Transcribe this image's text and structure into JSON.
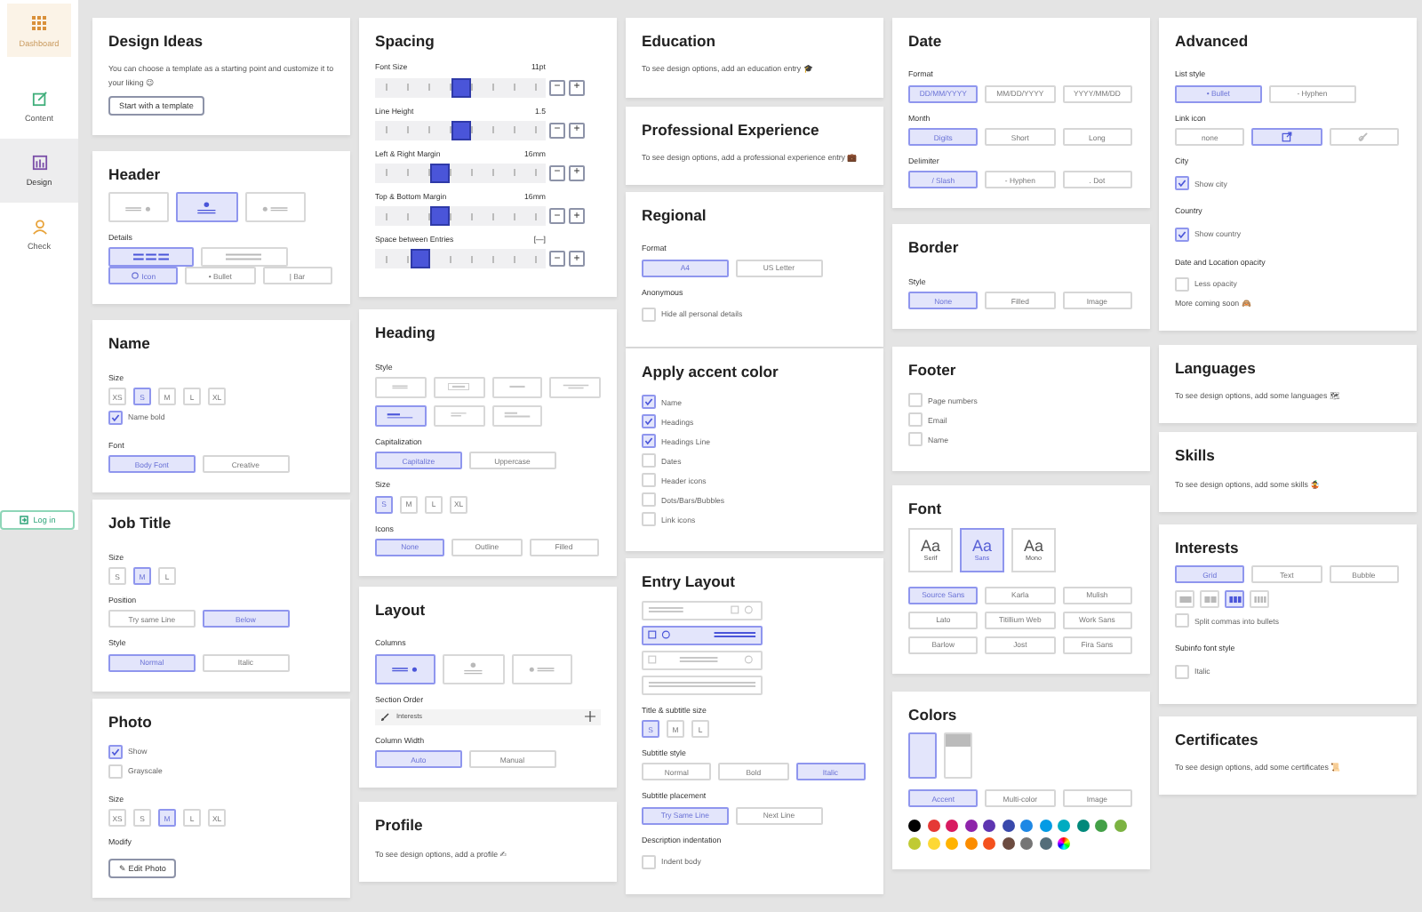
{
  "sidebar": {
    "items": [
      {
        "label": "Dashboard",
        "selected": false,
        "hovered": true,
        "color": "#d9903a"
      },
      {
        "label": "Content",
        "selected": false,
        "hovered": false,
        "color": "#3fae7a"
      },
      {
        "label": "Design",
        "selected": true,
        "hovered": false,
        "color": "#7b4fa8"
      },
      {
        "label": "Check",
        "selected": false,
        "hovered": false,
        "color": "#e8a33a"
      }
    ],
    "login": "Log in"
  },
  "columns": [
    {
      "cards": [
        {
          "title": "Design Ideas",
          "blocks": [
            {
              "kind": "text",
              "text": "You can choose a template as a starting point and customize it to your liking 😉"
            },
            {
              "kind": "button",
              "label": "Start with a template"
            }
          ]
        },
        {
          "title": "Header",
          "blocks": [
            {
              "kind": "shapes-large",
              "options": [
                {
                  "selected": false
                },
                {
                  "selected": true
                },
                {
                  "selected": false
                }
              ]
            },
            {
              "kind": "label",
              "text": "Details"
            },
            {
              "kind": "shapes-wide",
              "options": [
                {
                  "selected": true
                },
                {
                  "selected": false
                }
              ]
            },
            {
              "kind": "choices",
              "options": [
                {
                  "label": "Icon",
                  "selected": true,
                  "icon": true
                },
                {
                  "label": "• Bullet",
                  "selected": false,
                  "icon": false
                },
                {
                  "label": "| Bar",
                  "selected": false,
                  "icon": false
                }
              ]
            }
          ]
        },
        {
          "title": "Name",
          "blocks": [
            {
              "kind": "label",
              "text": "Size"
            },
            {
              "kind": "sizes",
              "options": [
                {
                  "label": "XS",
                  "selected": false
                },
                {
                  "label": "S",
                  "selected": true
                },
                {
                  "label": "M",
                  "selected": false
                },
                {
                  "label": "L",
                  "selected": false
                },
                {
                  "label": "XL",
                  "selected": false
                }
              ]
            },
            {
              "kind": "checkbox",
              "label": "Name bold",
              "checked": true
            },
            {
              "kind": "label",
              "text": "Font"
            },
            {
              "kind": "choices",
              "options": [
                {
                  "label": "Body Font",
                  "selected": true
                },
                {
                  "label": "Creative",
                  "selected": false
                }
              ]
            }
          ]
        },
        {
          "title": "Job Title",
          "blocks": [
            {
              "kind": "label",
              "text": "Size"
            },
            {
              "kind": "sizes",
              "options": [
                {
                  "label": "S",
                  "selected": false
                },
                {
                  "label": "M",
                  "selected": true
                },
                {
                  "label": "L",
                  "selected": false
                }
              ]
            },
            {
              "kind": "label",
              "text": "Position"
            },
            {
              "kind": "choices",
              "options": [
                {
                  "label": "Try same Line",
                  "selected": false
                },
                {
                  "label": "Below",
                  "selected": true
                }
              ]
            },
            {
              "kind": "label",
              "text": "Style"
            },
            {
              "kind": "choices",
              "options": [
                {
                  "label": "Normal",
                  "selected": true
                },
                {
                  "label": "Italic",
                  "selected": false
                }
              ]
            }
          ]
        },
        {
          "title": "Photo",
          "blocks": [
            {
              "kind": "checkbox",
              "label": "Show",
              "checked": true
            },
            {
              "kind": "checkbox",
              "label": "Grayscale",
              "checked": false
            },
            {
              "kind": "label",
              "text": "Size"
            },
            {
              "kind": "sizes",
              "options": [
                {
                  "label": "XS",
                  "selected": false
                },
                {
                  "label": "S",
                  "selected": false
                },
                {
                  "label": "M",
                  "selected": true
                },
                {
                  "label": "L",
                  "selected": false
                },
                {
                  "label": "XL",
                  "selected": false
                }
              ]
            },
            {
              "kind": "label",
              "text": "Modify"
            },
            {
              "kind": "button",
              "label": "✎ Edit Photo"
            }
          ]
        }
      ]
    },
    {
      "cards": [
        {
          "title": "Spacing",
          "blocks": [
            {
              "kind": "slider",
              "label": "Font Size",
              "reading": "11pt",
              "level": 0.5,
              "minus": "−",
              "plus": "+"
            },
            {
              "kind": "slider",
              "label": "Line Height",
              "reading": "1.5",
              "level": 0.5,
              "minus": "−",
              "plus": "+"
            },
            {
              "kind": "slider",
              "label": "Left & Right Margin",
              "reading": "16mm",
              "level": 0.36,
              "minus": "−",
              "plus": "+"
            },
            {
              "kind": "slider",
              "label": "Top & Bottom Margin",
              "reading": "16mm",
              "level": 0.36,
              "minus": "−",
              "plus": "+"
            },
            {
              "kind": "slider",
              "label": "Space between Entries",
              "reading": "[—]",
              "level": 0.24,
              "minus": "−",
              "plus": "+"
            }
          ]
        },
        {
          "title": "Heading",
          "blocks": [
            {
              "kind": "label",
              "text": "Style"
            },
            {
              "kind": "shapes-grid",
              "options": [
                {
                  "selected": false
                },
                {
                  "selected": false
                },
                {
                  "selected": false
                },
                {
                  "selected": false
                },
                {
                  "selected": true
                },
                {
                  "selected": false
                },
                {
                  "selected": false
                }
              ]
            },
            {
              "kind": "label",
              "text": "Capitalization"
            },
            {
              "kind": "choices",
              "options": [
                {
                  "label": "Capitalize",
                  "selected": true
                },
                {
                  "label": "Uppercase",
                  "selected": false
                }
              ]
            },
            {
              "kind": "label",
              "text": "Size"
            },
            {
              "kind": "sizes",
              "options": [
                {
                  "label": "S",
                  "selected": true
                },
                {
                  "label": "M",
                  "selected": false
                },
                {
                  "label": "L",
                  "selected": false
                },
                {
                  "label": "XL",
                  "selected": false
                }
              ]
            },
            {
              "kind": "label",
              "text": "Icons"
            },
            {
              "kind": "choices",
              "options": [
                {
                  "label": "None",
                  "selected": true
                },
                {
                  "label": "Outline",
                  "selected": false
                },
                {
                  "label": "Filled",
                  "selected": false
                }
              ]
            }
          ]
        },
        {
          "title": "Layout",
          "blocks": [
            {
              "kind": "label",
              "text": "Columns"
            },
            {
              "kind": "shapes-large",
              "options": [
                {
                  "selected": true
                },
                {
                  "selected": false
                },
                {
                  "selected": false
                }
              ]
            },
            {
              "kind": "label",
              "text": "Section Order"
            },
            {
              "kind": "sort-row",
              "text": "Interests"
            },
            {
              "kind": "label",
              "text": "Column Width"
            },
            {
              "kind": "choices",
              "options": [
                {
                  "label": "Auto",
                  "selected": true
                },
                {
                  "label": "Manual",
                  "selected": false
                }
              ]
            }
          ]
        },
        {
          "title": "Profile",
          "blocks": [
            {
              "kind": "text",
              "text": "To see design options, add a profile ✍"
            }
          ]
        }
      ]
    },
    {
      "cards": [
        {
          "title": "Education",
          "blocks": [
            {
              "kind": "text",
              "text": "To see design options, add an education entry 🎓"
            }
          ]
        },
        {
          "title": "Professional Experience",
          "blocks": [
            {
              "kind": "text",
              "text": "To see design options, add a professional experience entry 💼"
            }
          ]
        },
        {
          "title": "Regional",
          "blocks": [
            {
              "kind": "label",
              "text": "Format"
            },
            {
              "kind": "choices",
              "options": [
                {
                  "label": "A4",
                  "selected": true
                },
                {
                  "label": "US Letter",
                  "selected": false
                }
              ]
            },
            {
              "kind": "label",
              "text": "Anonymous"
            },
            {
              "kind": "checkbox",
              "label": "Hide all personal details",
              "checked": false
            }
          ]
        },
        {
          "title": "Apply accent color",
          "blocks": [
            {
              "kind": "checkbox",
              "label": "Name",
              "checked": true
            },
            {
              "kind": "checkbox",
              "label": "Headings",
              "checked": true
            },
            {
              "kind": "checkbox",
              "label": "Headings Line",
              "checked": true
            },
            {
              "kind": "checkbox",
              "label": "Dates",
              "checked": false
            },
            {
              "kind": "checkbox",
              "label": "Header icons",
              "checked": false
            },
            {
              "kind": "checkbox",
              "label": "Dots/Bars/Bubbles",
              "checked": false
            },
            {
              "kind": "checkbox",
              "label": "Link icons",
              "checked": false
            }
          ]
        },
        {
          "title": "Entry Layout",
          "blocks": [
            {
              "kind": "shapes-stack",
              "options": [
                {
                  "selected": false
                },
                {
                  "selected": true
                },
                {
                  "selected": false
                },
                {
                  "selected": false
                }
              ]
            },
            {
              "kind": "label",
              "text": "Title & subtitle size"
            },
            {
              "kind": "sizes",
              "options": [
                {
                  "label": "S",
                  "selected": true
                },
                {
                  "label": "M",
                  "selected": false
                },
                {
                  "label": "L",
                  "selected": false
                }
              ]
            },
            {
              "kind": "label",
              "text": "Subtitle style"
            },
            {
              "kind": "choices",
              "options": [
                {
                  "label": "Normal",
                  "selected": false
                },
                {
                  "label": "Bold",
                  "selected": false
                },
                {
                  "label": "Italic",
                  "selected": true
                }
              ]
            },
            {
              "kind": "label",
              "text": "Subtitle placement"
            },
            {
              "kind": "choices",
              "options": [
                {
                  "label": "Try Same Line",
                  "selected": true
                },
                {
                  "label": "Next Line",
                  "selected": false
                }
              ]
            },
            {
              "kind": "label",
              "text": "Description indentation"
            },
            {
              "kind": "checkbox",
              "label": "Indent body",
              "checked": false
            }
          ]
        }
      ]
    },
    {
      "cards": [
        {
          "title": "Date",
          "blocks": [
            {
              "kind": "label",
              "text": "Format"
            },
            {
              "kind": "choices",
              "options": [
                {
                  "label": "DD/MM/YYYY",
                  "selected": true
                },
                {
                  "label": "MM/DD/YYYY",
                  "selected": false
                },
                {
                  "label": "YYYY/MM/DD",
                  "selected": false
                }
              ]
            },
            {
              "kind": "label",
              "text": "Month"
            },
            {
              "kind": "choices",
              "options": [
                {
                  "label": "Digits",
                  "selected": true
                },
                {
                  "label": "Short",
                  "selected": false
                },
                {
                  "label": "Long",
                  "selected": false
                }
              ]
            },
            {
              "kind": "label",
              "text": "Delimiter"
            },
            {
              "kind": "choices",
              "options": [
                {
                  "label": "/ Slash",
                  "selected": true
                },
                {
                  "label": "- Hyphen",
                  "selected": false
                },
                {
                  "label": ". Dot",
                  "selected": false
                }
              ]
            }
          ]
        },
        {
          "title": "Border",
          "blocks": [
            {
              "kind": "label",
              "text": "Style"
            },
            {
              "kind": "choices",
              "options": [
                {
                  "label": "None",
                  "selected": true
                },
                {
                  "label": "Filled",
                  "selected": false
                },
                {
                  "label": "Image",
                  "selected": false
                }
              ]
            }
          ]
        },
        {
          "title": "Footer",
          "blocks": [
            {
              "kind": "checkbox",
              "label": "Page numbers",
              "checked": false
            },
            {
              "kind": "checkbox",
              "label": "Email",
              "checked": false
            },
            {
              "kind": "checkbox",
              "label": "Name",
              "checked": false
            }
          ]
        },
        {
          "title": "Font",
          "blocks": [
            {
              "kind": "font-tiles",
              "options": [
                {
                  "sample": "Aa",
                  "label": "Serif",
                  "selected": false
                },
                {
                  "sample": "Aa",
                  "label": "Sans",
                  "selected": true
                },
                {
                  "sample": "Aa",
                  "label": "Mono",
                  "selected": false
                }
              ]
            },
            {
              "kind": "choices",
              "options": [
                {
                  "label": "Source Sans",
                  "selected": true
                },
                {
                  "label": "Karla",
                  "selected": false
                },
                {
                  "label": "Mulish",
                  "selected": false
                },
                {
                  "label": "Lato",
                  "selected": false
                },
                {
                  "label": "Titillium Web",
                  "selected": false
                },
                {
                  "label": "Work Sans",
                  "selected": false
                },
                {
                  "label": "Barlow",
                  "selected": false
                },
                {
                  "label": "Jost",
                  "selected": false
                },
                {
                  "label": "Fira Sans",
                  "selected": false
                }
              ]
            }
          ]
        },
        {
          "title": "Colors",
          "blocks": [
            {
              "kind": "shapes-pages",
              "options": [
                {
                  "selected": true
                },
                {
                  "selected": false
                }
              ]
            },
            {
              "kind": "choices",
              "options": [
                {
                  "label": "Accent",
                  "selected": true
                },
                {
                  "label": "Multi-color",
                  "selected": false
                },
                {
                  "label": "Image",
                  "selected": false
                }
              ]
            },
            {
              "kind": "swatches",
              "picker": true,
              "colors": [
                {
                  "color": "#000000"
                },
                {
                  "color": "#e53935"
                },
                {
                  "color": "#d81b60"
                },
                {
                  "color": "#8e24aa"
                },
                {
                  "color": "#5e35b1"
                },
                {
                  "color": "#3949ab"
                },
                {
                  "color": "#1e88e5"
                },
                {
                  "color": "#039be5"
                },
                {
                  "color": "#00acc1"
                },
                {
                  "color": "#00897b"
                },
                {
                  "color": "#43a047"
                },
                {
                  "color": "#7cb342"
                },
                {
                  "color": "#c0ca33"
                },
                {
                  "color": "#fdd835"
                },
                {
                  "color": "#ffb300"
                },
                {
                  "color": "#fb8c00"
                },
                {
                  "color": "#f4511e"
                },
                {
                  "color": "#6d4c41"
                },
                {
                  "color": "#757575"
                },
                {
                  "color": "#546e7a"
                }
              ]
            }
          ]
        }
      ]
    },
    {
      "cards": [
        {
          "title": "Advanced",
          "blocks": [
            {
              "kind": "label",
              "text": "List style"
            },
            {
              "kind": "choices",
              "options": [
                {
                  "label": "• Bullet",
                  "selected": true
                },
                {
                  "label": "- Hyphen",
                  "selected": false
                }
              ]
            },
            {
              "kind": "label",
              "text": "Link icon"
            },
            {
              "kind": "choices",
              "options": [
                {
                  "label": "none",
                  "selected": false
                },
                {
                  "selected": true
                },
                {
                  "selected": false
                }
              ]
            },
            {
              "kind": "label",
              "text": "City"
            },
            {
              "kind": "checkbox",
              "label": "Show city",
              "checked": true
            },
            {
              "kind": "label",
              "text": "Country"
            },
            {
              "kind": "checkbox",
              "label": "Show country",
              "checked": true
            },
            {
              "kind": "label",
              "text": "Date and Location opacity"
            },
            {
              "kind": "checkbox",
              "label": "Less opacity",
              "checked": false
            },
            {
              "kind": "text",
              "text": "More coming soon 🙈"
            }
          ]
        },
        {
          "title": "Languages",
          "blocks": [
            {
              "kind": "text",
              "text": "To see design options, add some languages 🗺"
            }
          ]
        },
        {
          "title": "Skills",
          "blocks": [
            {
              "kind": "text",
              "text": "To see design options, add some skills 🤹"
            }
          ]
        },
        {
          "title": "Interests",
          "blocks": [
            {
              "kind": "choices",
              "options": [
                {
                  "label": "Grid",
                  "selected": true
                },
                {
                  "label": "Text",
                  "selected": false
                },
                {
                  "label": "Bubble",
                  "selected": false
                }
              ]
            },
            {
              "kind": "shapes-small",
              "options": [
                {
                  "selected": false
                },
                {
                  "selected": false
                },
                {
                  "selected": true
                },
                {
                  "selected": false
                }
              ]
            },
            {
              "kind": "checkbox",
              "label": "Split commas into bullets",
              "checked": false
            },
            {
              "kind": "label",
              "text": "Subinfo font style"
            },
            {
              "kind": "checkbox",
              "label": "Italic",
              "checked": false
            }
          ]
        },
        {
          "title": "Certificates",
          "blocks": [
            {
              "kind": "text",
              "text": "To see design options, add some certificates 📜"
            }
          ]
        }
      ]
    }
  ]
}
